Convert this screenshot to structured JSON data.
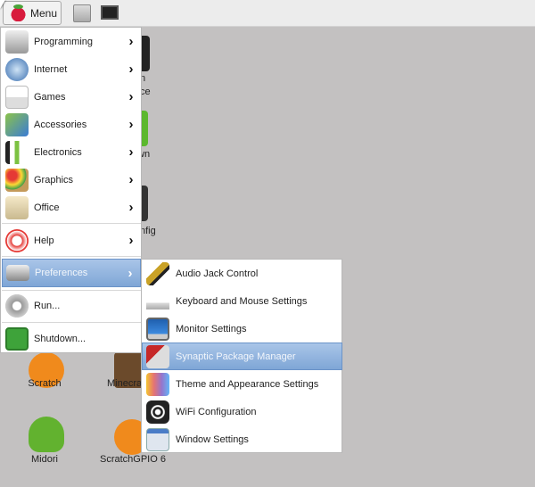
{
  "taskbar": {
    "menu_label": "Menu",
    "launchers": [
      {
        "icon": "file-manager-icon"
      },
      {
        "icon": "terminal-icon"
      }
    ]
  },
  "desktop": {
    "partial_labels": [
      "n",
      "ce",
      "wn",
      "nfig"
    ],
    "icons": [
      {
        "label": "Scratch"
      },
      {
        "label": "Minecra"
      },
      {
        "label": "Midori"
      },
      {
        "label": "ScratchGPIO 6"
      }
    ]
  },
  "menu": {
    "items": [
      {
        "label": "Programming",
        "icon": "programming-icon",
        "submenu": true
      },
      {
        "label": "Internet",
        "icon": "globe-icon",
        "submenu": true
      },
      {
        "label": "Games",
        "icon": "joystick-icon",
        "submenu": true
      },
      {
        "label": "Accessories",
        "icon": "accessories-icon",
        "submenu": true
      },
      {
        "label": "Electronics",
        "icon": "electronics-icon",
        "submenu": true
      },
      {
        "label": "Graphics",
        "icon": "palette-icon",
        "submenu": true
      },
      {
        "label": "Office",
        "icon": "office-icon",
        "submenu": true
      },
      {
        "label": "Help",
        "icon": "lifebuoy-icon",
        "submenu": true
      },
      {
        "label": "Preferences",
        "icon": "preferences-icon",
        "submenu": true,
        "selected": true
      },
      {
        "label": "Run...",
        "icon": "gears-icon"
      },
      {
        "label": "Shutdown...",
        "icon": "exit-icon"
      }
    ]
  },
  "submenu": {
    "items": [
      {
        "label": "Audio Jack Control",
        "icon": "audio-jack-icon"
      },
      {
        "label": "Keyboard and Mouse Settings",
        "icon": "keyboard-icon"
      },
      {
        "label": "Monitor Settings",
        "icon": "monitor-icon"
      },
      {
        "label": "Synaptic Package Manager",
        "icon": "package-icon",
        "selected": true
      },
      {
        "label": "Theme and Appearance Settings",
        "icon": "swatches-icon"
      },
      {
        "label": "WiFi Configuration",
        "icon": "wifi-icon"
      },
      {
        "label": "Window Settings",
        "icon": "window-settings-icon"
      }
    ]
  },
  "colors": {
    "selection": "#7fa6d6",
    "desktop": "#c3c1c1"
  }
}
